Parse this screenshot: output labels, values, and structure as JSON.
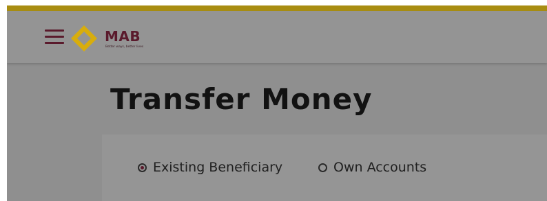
{
  "brand": {
    "name": "MAB",
    "tagline": "Better ways, better lives",
    "colors": {
      "accent_gold": "#a88d12",
      "brand_maroon": "#5a1a2c"
    },
    "menu_icon": "hamburger-menu-icon",
    "logo_icon": "mab-diamond-logo-icon"
  },
  "page": {
    "title": "Transfer Money"
  },
  "transfer_type": {
    "options": [
      {
        "label": "Existing Beneficiary",
        "selected": true
      },
      {
        "label": "Own Accounts",
        "selected": false
      }
    ]
  }
}
